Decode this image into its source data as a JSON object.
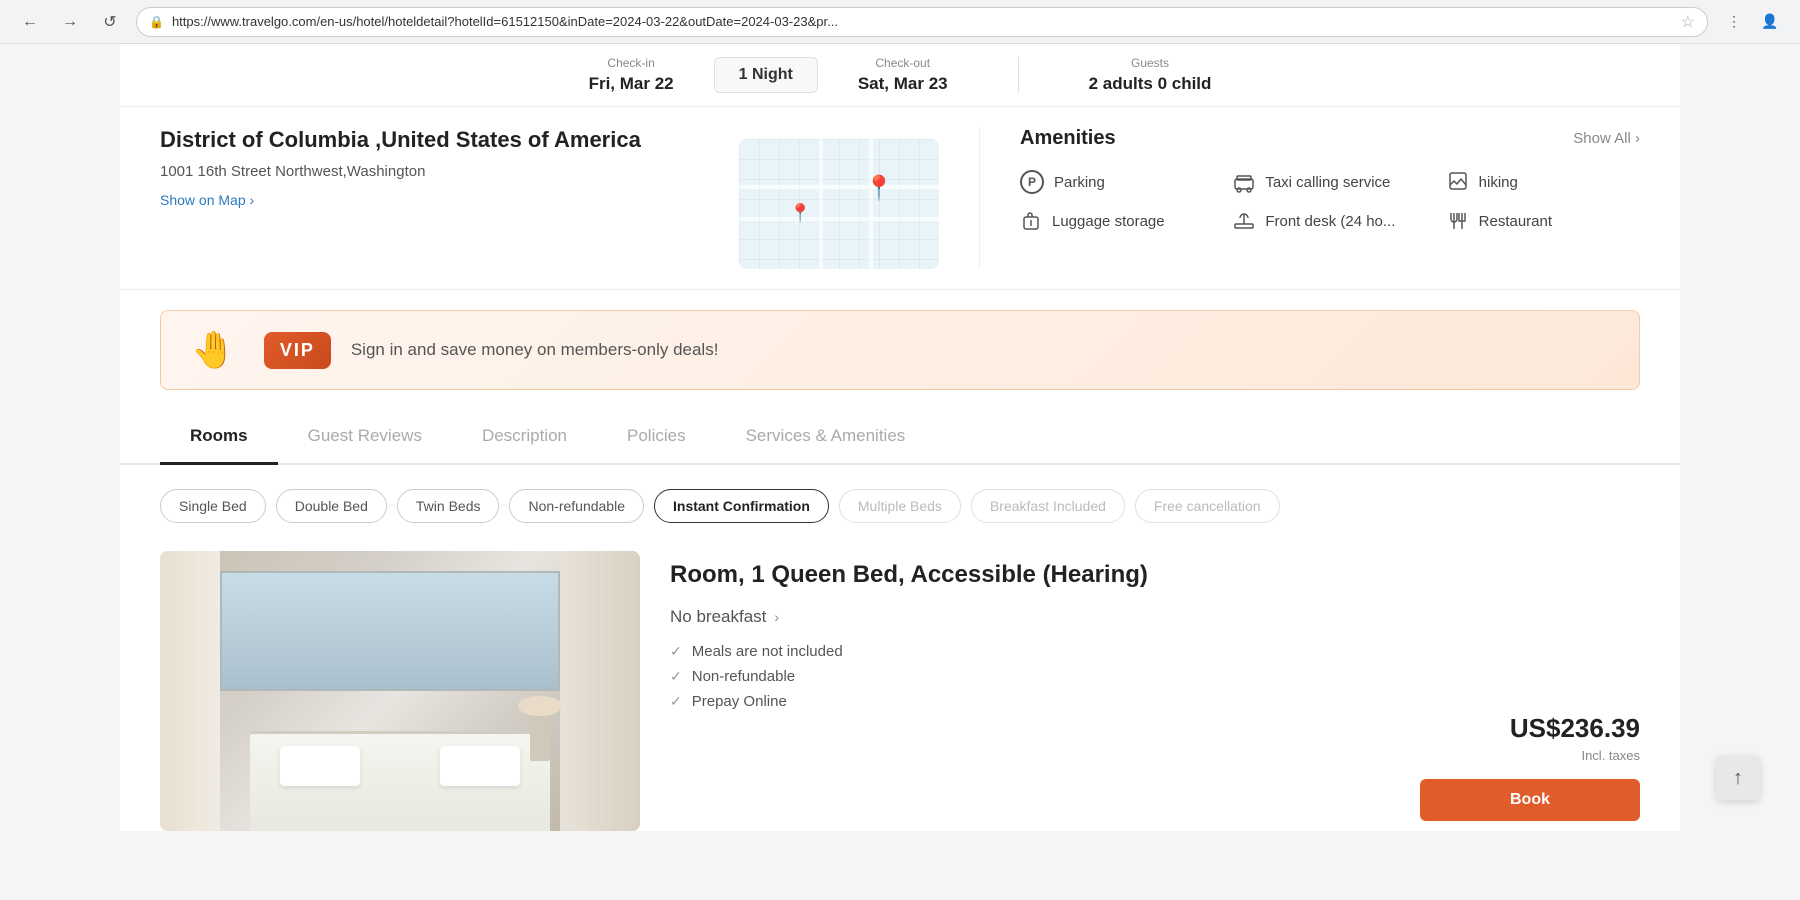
{
  "browser": {
    "url": "https://www.travelgo.com/en-us/hotel/hoteldetail?hotelId=61512150&inDate=2024-03-22&outDate=2024-03-23&pr...",
    "back_icon": "←",
    "forward_icon": "→",
    "refresh_icon": "↺",
    "star_icon": "☆",
    "shield_icon": "🔒"
  },
  "booking_bar": {
    "checkin_label": "Check-in",
    "checkin_value": "Fri, Mar 22",
    "night_badge": "1 Night",
    "checkout_label": "Check-out",
    "checkout_value": "Sat, Mar 23",
    "guests_label": "Guests",
    "guests_value": "2 adults 0 child"
  },
  "hotel_info": {
    "location": "District of Columbia ,United States of America",
    "address": "1001 16th Street Northwest,Washington",
    "show_map_label": "Show on Map ›"
  },
  "amenities": {
    "title": "Amenities",
    "show_all_label": "Show All ›",
    "items": [
      {
        "icon": "P",
        "label": "Parking",
        "icon_type": "parking"
      },
      {
        "icon": "🚕",
        "label": "Taxi calling service",
        "icon_type": "taxi"
      },
      {
        "icon": "🥾",
        "label": "hiking",
        "icon_type": "hiking"
      },
      {
        "icon": "🧳",
        "label": "Luggage storage",
        "icon_type": "luggage"
      },
      {
        "icon": "🛎",
        "label": "Front desk (24 ho...",
        "icon_type": "frontdesk"
      },
      {
        "icon": "🍽",
        "label": "Restaurant",
        "icon_type": "restaurant"
      }
    ]
  },
  "vip_banner": {
    "badge": "VIP",
    "text": "Sign in and save money on members-only deals!",
    "hand_emoji": "🤚"
  },
  "tabs": [
    {
      "id": "rooms",
      "label": "Rooms",
      "active": true
    },
    {
      "id": "reviews",
      "label": "Guest Reviews",
      "active": false
    },
    {
      "id": "description",
      "label": "Description",
      "active": false
    },
    {
      "id": "policies",
      "label": "Policies",
      "active": false
    },
    {
      "id": "services",
      "label": "Services & Amenities",
      "active": false
    }
  ],
  "room_filters": [
    {
      "id": "single",
      "label": "Single Bed",
      "state": "normal"
    },
    {
      "id": "double",
      "label": "Double Bed",
      "state": "normal"
    },
    {
      "id": "twin",
      "label": "Twin Beds",
      "state": "normal"
    },
    {
      "id": "nonrefund",
      "label": "Non-refundable",
      "state": "normal"
    },
    {
      "id": "instant",
      "label": "Instant Confirmation",
      "state": "active"
    },
    {
      "id": "multiple",
      "label": "Multiple Beds",
      "state": "dimmed"
    },
    {
      "id": "breakfast",
      "label": "Breakfast Included",
      "state": "dimmed"
    },
    {
      "id": "freecancellation",
      "label": "Free cancellation",
      "state": "dimmed"
    }
  ],
  "room": {
    "title": "Room, 1 Queen Bed, Accessible (Hearing)",
    "meal_label": "No breakfast",
    "meal_chevron": "›",
    "features": [
      "Meals are not included",
      "Non-refundable",
      "Prepay Online"
    ],
    "price": "US$236.39",
    "price_note": "Incl. taxes",
    "book_label": "Book"
  },
  "scroll_up": "↑"
}
